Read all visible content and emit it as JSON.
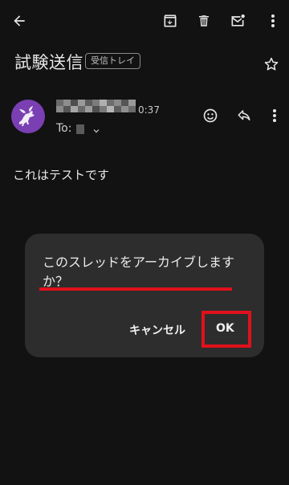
{
  "appbar": {
    "back_icon": "arrow-left-icon",
    "actions": [
      "archive-icon",
      "delete-icon",
      "mark-unread-icon",
      "more-vert-icon"
    ]
  },
  "email": {
    "subject": "試験送信",
    "label": "受信トレイ",
    "time": "0:37",
    "to_label": "To:",
    "body": "これはテストです"
  },
  "sender_actions": [
    "smiley-icon",
    "reply-icon",
    "more-vert-icon"
  ],
  "dialog": {
    "message": "このスレッドをアーカイブしますか？",
    "cancel_label": "キャンセル",
    "ok_label": "OK",
    "highlight_color": "#e0111b"
  },
  "colors": {
    "background": "#121212",
    "dialog_bg": "#2d2d2d",
    "avatar_bg": "#7a3fb3"
  }
}
